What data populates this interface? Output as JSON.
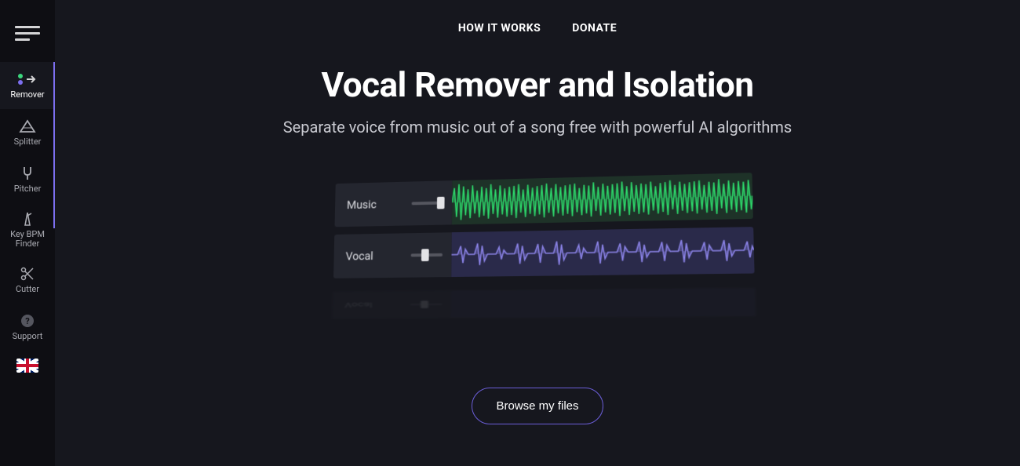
{
  "sidebar": {
    "items": [
      {
        "label": "Remover"
      },
      {
        "label": "Splitter"
      },
      {
        "label": "Pitcher"
      },
      {
        "label": "Key BPM\nFinder"
      },
      {
        "label": "Cutter"
      },
      {
        "label": "Support"
      }
    ]
  },
  "topnav": {
    "how_it_works": "HOW IT WORKS",
    "donate": "DONATE"
  },
  "hero": {
    "title": "Vocal Remover and Isolation",
    "subtitle": "Separate voice from music out of a song free with powerful AI algorithms"
  },
  "tracks": {
    "music_label": "Music",
    "vocal_label": "Vocal"
  },
  "cta": {
    "browse": "Browse my files"
  }
}
